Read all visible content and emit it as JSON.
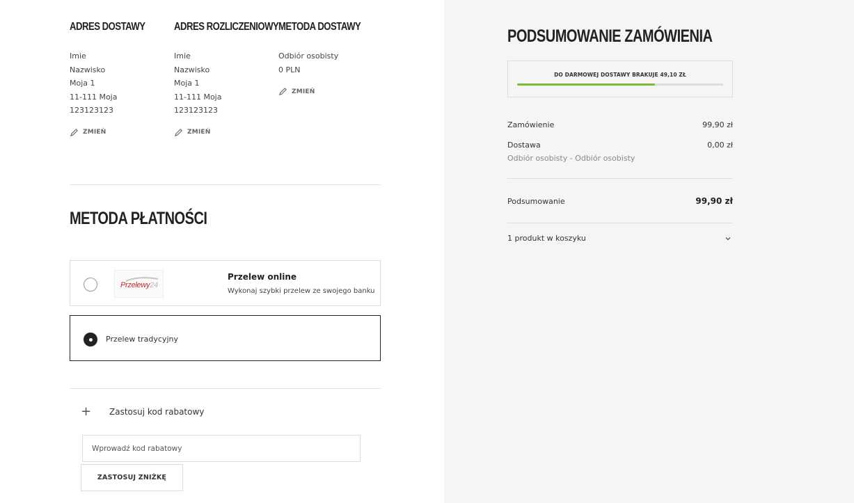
{
  "delivery_address": {
    "heading": "ADRES DOSTAWY",
    "lines": [
      "Imie",
      "Nazwisko",
      "Moja 1",
      "11-111 Moja",
      "123123123"
    ],
    "edit_label": "ZMIEŃ"
  },
  "billing_address": {
    "heading": "ADRES ROZLICZENIOWY",
    "lines": [
      "Imie",
      "Nazwisko",
      "Moja 1",
      "11-111 Moja",
      "123123123"
    ],
    "edit_label": "ZMIEŃ"
  },
  "delivery_method": {
    "heading": "METODA DOSTAWY",
    "lines": [
      "Odbiór osobisty",
      "0 PLN"
    ],
    "edit_label": "ZMIEŃ"
  },
  "payment": {
    "heading": "METODA PŁATNOŚCI",
    "options": [
      {
        "title": "Przelew online",
        "description": "Wykonaj szybki przelew ze swojego banku",
        "logo_text": "Przelewy",
        "logo_suffix": "24",
        "selected": false
      },
      {
        "label": "Przelew tradycyjny",
        "selected": true
      }
    ]
  },
  "promo": {
    "toggle_icon": "+",
    "toggle_label": "Zastosuj kod rabatowy",
    "input_placeholder": "Wprowadź kod rabatowy",
    "button_label": "ZASTOSUJ ZNIŻKĘ"
  },
  "summary": {
    "heading": "PODSUMOWANIE ZAMÓWIENIA",
    "free_shipping_text": "DO DARMOWEJ DOSTAWY BRAKUJE 49,10 ZŁ",
    "free_shipping_progress_pct": 67,
    "order_label": "Zamówienie",
    "order_value": "99,90 zł",
    "shipping_label": "Dostawa",
    "shipping_value": "0,00 zł",
    "shipping_detail": "Odbiór osobisty - Odbiór osobisty",
    "total_label": "Podsumowanie",
    "total_value": "99,90 zł",
    "cart_count_label": "1 produkt w koszyku"
  },
  "colors": {
    "accent_green": "#7ab838",
    "text_dark": "#222222",
    "panel_bg": "#f5f5f5"
  }
}
